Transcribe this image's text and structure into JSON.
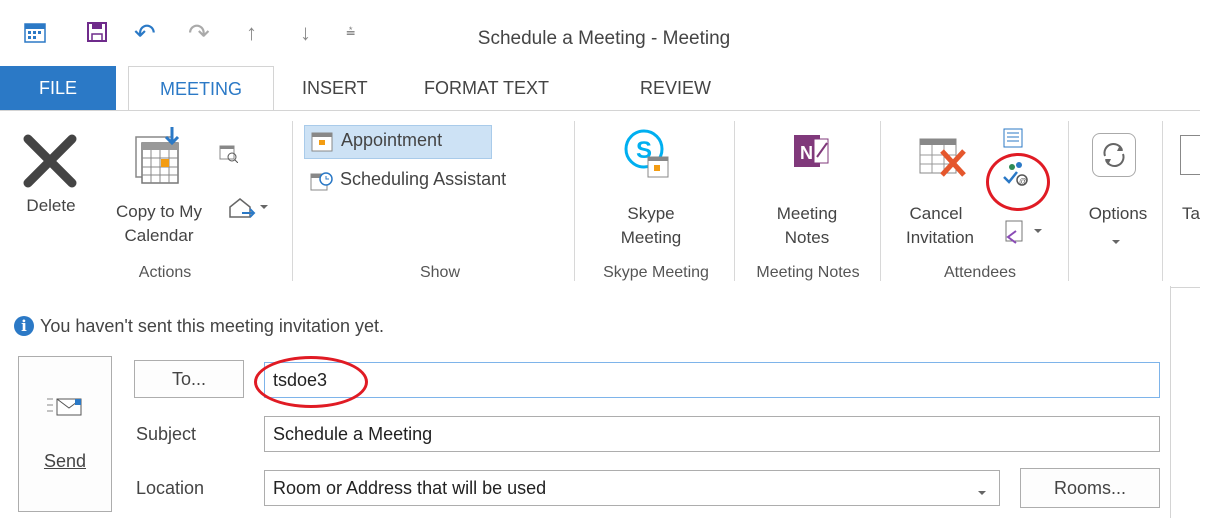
{
  "window": {
    "title": "Schedule a Meeting - Meeting"
  },
  "qat": {
    "undo": "↶",
    "redo": "↷",
    "up": "↑",
    "down": "↓",
    "more": "⩮"
  },
  "tabs": [
    {
      "label": "FILE"
    },
    {
      "label": "MEETING"
    },
    {
      "label": "INSERT"
    },
    {
      "label": "FORMAT TEXT"
    },
    {
      "label": "REVIEW"
    }
  ],
  "ribbon": {
    "actions": {
      "delete": "Delete",
      "copy_line1": "Copy to My",
      "copy_line2": "Calendar",
      "group": "Actions"
    },
    "show": {
      "appointment": "Appointment",
      "scheduling": "Scheduling Assistant",
      "group": "Show"
    },
    "skype": {
      "line1": "Skype",
      "line2": "Meeting",
      "group": "Skype Meeting"
    },
    "notes": {
      "line1": "Meeting",
      "line2": "Notes",
      "group": "Meeting Notes"
    },
    "attendees": {
      "line1": "Cancel",
      "line2": "Invitation",
      "group": "Attendees"
    },
    "options": {
      "label": "Options"
    },
    "tags": {
      "label": "Ta"
    }
  },
  "form": {
    "info": "You haven't sent this meeting invitation yet.",
    "send": "Send",
    "to_button": "To...",
    "to_value": "tsdoe3",
    "subject_label": "Subject",
    "subject_value": "Schedule a Meeting",
    "location_label": "Location",
    "location_value": "Room or Address that will be used",
    "rooms_button": "Rooms..."
  },
  "colors": {
    "accent": "#2b79c6",
    "annotation": "#e01b24"
  }
}
